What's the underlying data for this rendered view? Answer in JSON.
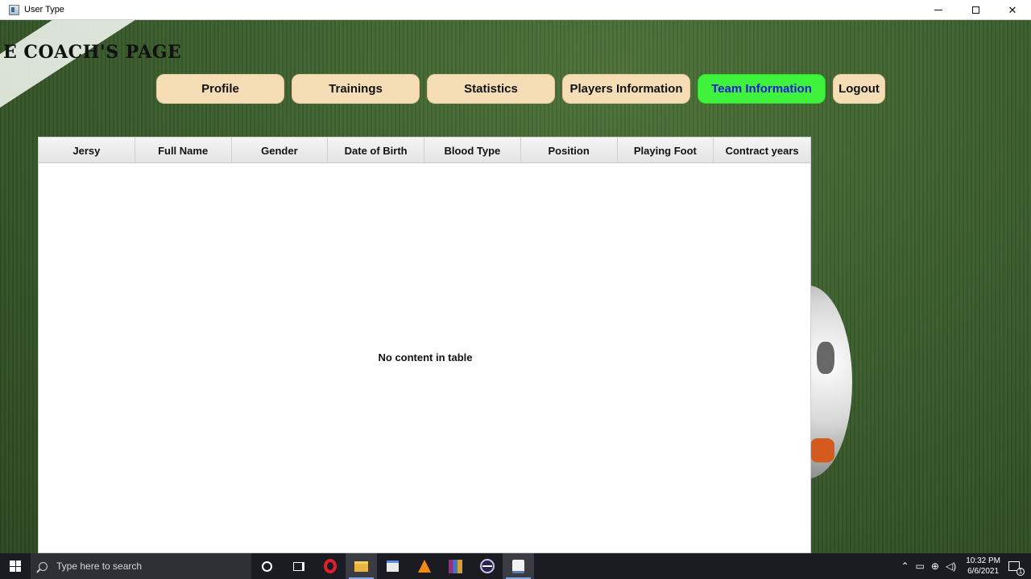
{
  "window": {
    "title": "User Type"
  },
  "page": {
    "heading": "E COACH'S PAGE"
  },
  "nav": [
    {
      "label": "Profile",
      "active": false
    },
    {
      "label": "Trainings",
      "active": false
    },
    {
      "label": "Statistics",
      "active": false
    },
    {
      "label": "Players Information",
      "active": false
    },
    {
      "label": "Team Information",
      "active": true
    },
    {
      "label": "Logout",
      "active": false
    }
  ],
  "table": {
    "columns": [
      "Jersy",
      "Full Name",
      "Gender",
      "Date of Birth",
      "Blood Type",
      "Position",
      "Playing Foot",
      "Contract years"
    ],
    "rows": [],
    "empty_message": "No content in table"
  },
  "taskbar": {
    "search_placeholder": "Type here to search",
    "apps": [
      "cortana-icon",
      "task-view-icon",
      "opera-icon",
      "file-explorer-icon",
      "store-icon",
      "vlc-icon",
      "winrar-icon",
      "eclipse-icon",
      "java-icon"
    ],
    "time": "10:32 PM",
    "date": "6/6/2021",
    "notification_count": "1"
  }
}
